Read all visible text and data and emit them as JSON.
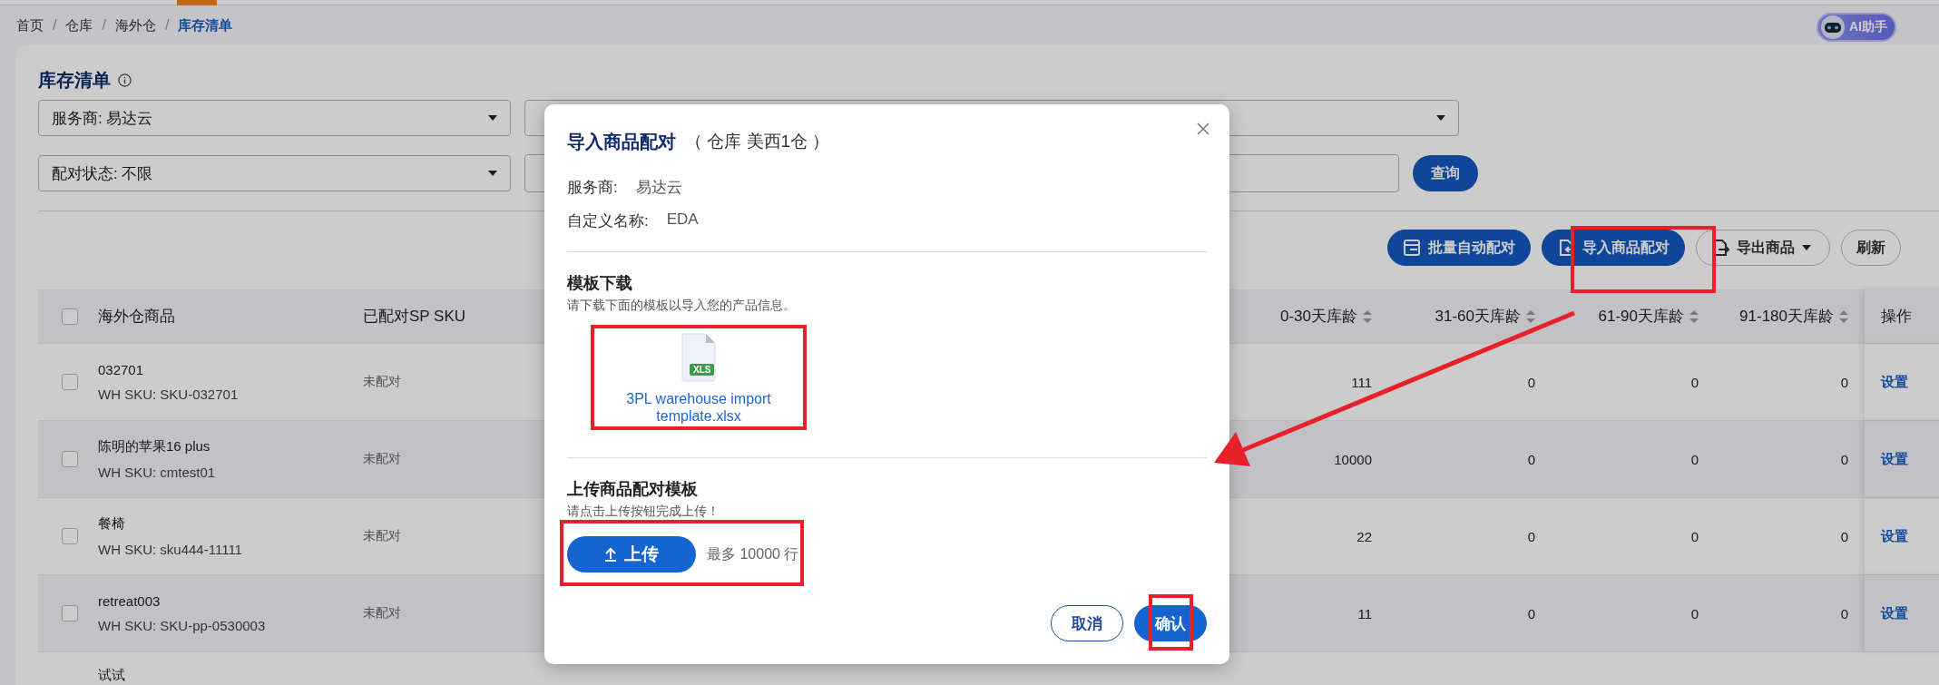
{
  "breadcrumb": [
    {
      "label": "首页",
      "selected": false
    },
    {
      "separator": "/",
      "label": "仓库",
      "selected": false
    },
    {
      "separator": "/",
      "label": "海外仓",
      "selected": false
    },
    {
      "separator": "/",
      "label": "库存清单",
      "selected": true
    }
  ],
  "ai_button": {
    "label": "AI助手"
  },
  "page": {
    "title": "库存清单"
  },
  "filters": [
    {
      "kind": "select",
      "value": "服务商: 易达云"
    },
    {
      "kind": "select",
      "value": "配对状态: 不限"
    }
  ],
  "query_button": {
    "label": "查询"
  },
  "actions": [
    {
      "kind": "primary",
      "label": "批量自动配对",
      "dropdown": false
    },
    {
      "kind": "primary",
      "label": "导入商品配对",
      "dropdown": false
    },
    {
      "kind": "outline",
      "label": "导出商品",
      "dropdown": true
    },
    {
      "kind": "outline",
      "label": "刷新",
      "dropdown": false
    }
  ],
  "table": {
    "header_checked": false,
    "columns": [
      {
        "label": "海外仓商品",
        "sortable": false
      },
      {
        "label": "已配对SP SKU",
        "sortable": false
      },
      {
        "label": "0-30天库龄",
        "sortable": true
      },
      {
        "label": "31-60天库龄",
        "sortable": true
      },
      {
        "label": "61-90天库龄",
        "sortable": true
      },
      {
        "label": "91-180天库龄",
        "sortable": true
      },
      {
        "label": "操作",
        "sortable": false
      }
    ],
    "rows": [
      {
        "checked": false,
        "name": "032701",
        "sku": "WH SKU: SKU-032701",
        "paired": "未配对",
        "ages": [
          "111",
          "0",
          "0",
          "0"
        ],
        "action": "设置"
      },
      {
        "checked": false,
        "name": "陈明的苹果16 plus",
        "sku": "WH SKU: cmtest01",
        "paired": "未配对",
        "ages": [
          "10000",
          "0",
          "0",
          "0"
        ],
        "action": "设置"
      },
      {
        "checked": false,
        "name": "餐椅",
        "sku": "WH SKU: sku444-11111",
        "paired": "未配对",
        "ages": [
          "22",
          "0",
          "0",
          "0"
        ],
        "action": "设置"
      },
      {
        "checked": false,
        "name": "retreat003",
        "sku": "WH SKU: SKU-pp-0530003",
        "paired": "未配对",
        "ages": [
          "11",
          "0",
          "0",
          "0"
        ],
        "action": "设置"
      },
      {
        "name": "试试"
      }
    ]
  },
  "dialog": {
    "title": "导入商品配对",
    "subtitle": "（ 仓库 美西1仓 ）",
    "fields": [
      {
        "label": "服务商:",
        "value": "易达云"
      },
      {
        "label": "自定义名称:",
        "value": "EDA"
      }
    ],
    "download": {
      "heading": "模板下载",
      "hint": "请下载下面的模板以导入您的产品信息。",
      "file_badge": "XLS",
      "file_name": "3PL warehouse import template.xlsx"
    },
    "upload": {
      "heading": "上传商品配对模板",
      "hint": "请点击上传按钮完成上传！",
      "button": "上传",
      "limit": "最多 10000 行"
    },
    "buttons": [
      {
        "kind": "secondary",
        "label": "取消"
      },
      {
        "kind": "primary",
        "label": "确认"
      }
    ]
  }
}
